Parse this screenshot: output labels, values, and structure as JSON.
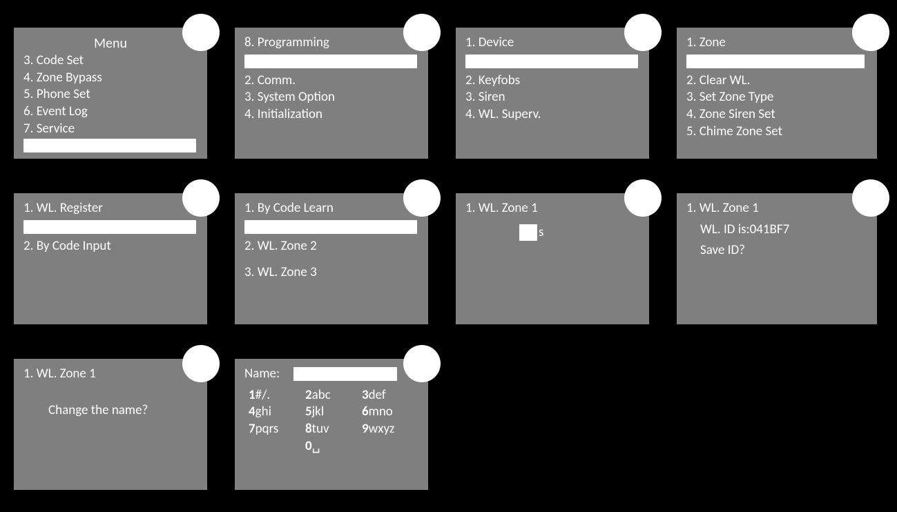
{
  "panels": {
    "menu": {
      "title": "Menu",
      "items": [
        "3. Code Set",
        "4. Zone Bypass",
        "5. Phone Set",
        "6. Event Log",
        "7. Service"
      ]
    },
    "programming": {
      "title": "8. Programming",
      "items": [
        "2. Comm.",
        "3. System Option",
        "4. Initialization"
      ]
    },
    "device": {
      "title": "1. Device",
      "items": [
        "2. Keyfobs",
        "3. Siren",
        "4. WL. Superv."
      ]
    },
    "zone": {
      "title": "1. Zone",
      "items": [
        "2. Clear WL.",
        "3. Set Zone Type",
        "4. Zone Siren Set",
        "5. Chime Zone Set"
      ]
    },
    "register": {
      "title": "1. WL. Register",
      "items": [
        "2. By Code Input"
      ]
    },
    "codelearn": {
      "title": "1. By Code Learn",
      "items": [
        "2. WL. Zone 2",
        "3. WL. Zone 3"
      ]
    },
    "wlzone1a": {
      "title": "1. WL. Zone 1",
      "suffix": "s"
    },
    "wlzone1b": {
      "title": "1. WL. Zone 1",
      "line1": "WL. ID is:041BF7",
      "line2": "Save ID?"
    },
    "wlzone1c": {
      "title": "1. WL. Zone 1",
      "line1": "Change the name?"
    },
    "namepad": {
      "label": "Name:",
      "keys": [
        {
          "n": "1",
          "l": "#/."
        },
        {
          "n": "2",
          "l": "abc"
        },
        {
          "n": "3",
          "l": "def"
        },
        {
          "n": "4",
          "l": "ghi"
        },
        {
          "n": "5",
          "l": "jkl"
        },
        {
          "n": "6",
          "l": "mno"
        },
        {
          "n": "7",
          "l": "pqrs"
        },
        {
          "n": "8",
          "l": "tuv"
        },
        {
          "n": "9",
          "l": "wxyz"
        },
        {
          "n": "0",
          "l": "␣"
        }
      ]
    }
  }
}
